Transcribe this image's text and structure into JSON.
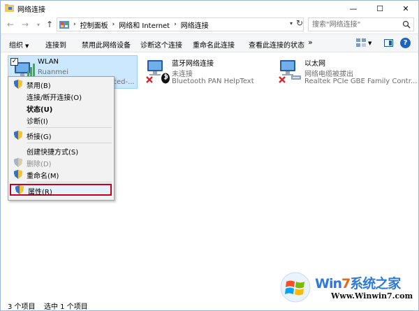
{
  "window": {
    "title": "网络连接",
    "controls": {
      "minimize": "—",
      "maximize": "☐",
      "close": "✕"
    }
  },
  "address": {
    "breadcrumbs": [
      "控制面板",
      "网络和 Internet",
      "网络连接"
    ],
    "search_placeholder": "搜索\"网络连接\""
  },
  "toolbar": {
    "organize": "组织",
    "commands": [
      "连接到",
      "禁用此网络设备",
      "诊断这个连接",
      "重命名此连接",
      "查看此连接的状态"
    ],
    "more": "»"
  },
  "connections": [
    {
      "name": "WLAN",
      "status": "Ruanmei",
      "device": "...ced-...",
      "type": "wifi",
      "selected": true
    },
    {
      "name": "蓝牙网络连接",
      "status": "未连接",
      "device": "Bluetooth PAN HelpText",
      "type": "bluetooth",
      "selected": false
    },
    {
      "name": "以太网",
      "status": "网络电缆被拔出",
      "device": "Realtek PCIe GBE Family Contr...",
      "type": "ethernet",
      "selected": false
    }
  ],
  "context_menu": {
    "items": [
      {
        "label": "禁用(B)",
        "shield": true
      },
      {
        "label": "连接/断开连接(O)",
        "shield": false
      },
      {
        "label": "状态(U)",
        "shield": false,
        "bold": true
      },
      {
        "label": "诊断(I)",
        "shield": false
      },
      {
        "label": "桥接(G)",
        "shield": true
      },
      {
        "label": "创建快捷方式(S)",
        "shield": false
      },
      {
        "label": "删除(D)",
        "shield": true,
        "disabled": true
      },
      {
        "label": "重命名(M)",
        "shield": true
      },
      {
        "label": "属性(R)",
        "shield": true,
        "highlighted": true
      }
    ]
  },
  "statusbar": {
    "item_count": "3 个项目",
    "selected": "选中 1 个项目"
  },
  "watermark": {
    "brand_prefix": "Win",
    "brand_seven": "7",
    "brand_suffix": "系统之家",
    "url": "Www.Winwin7.com"
  },
  "colors": {
    "selection_bg": "#cce8ff",
    "highlight_border": "#c4001f",
    "toolbar_bg": "#f5f6f7"
  }
}
